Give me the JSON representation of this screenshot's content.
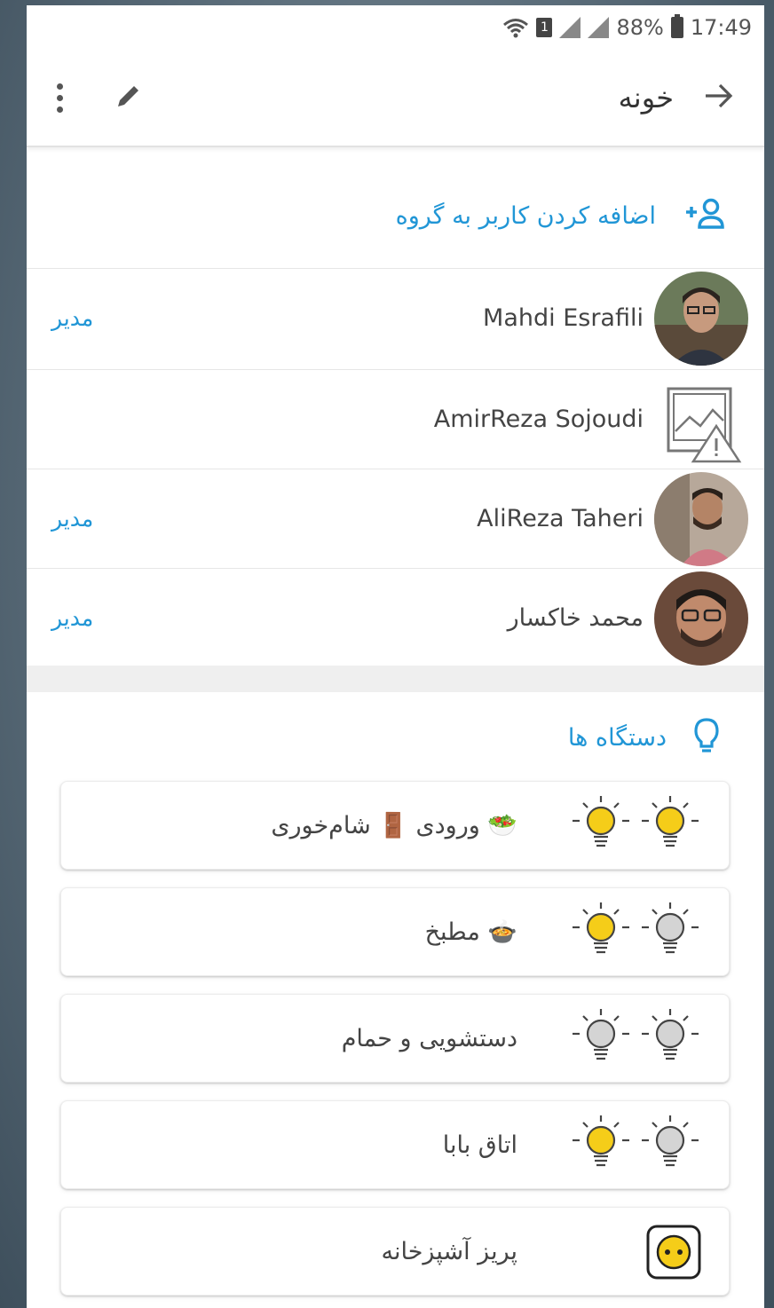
{
  "status_bar": {
    "battery": "88%",
    "time": "17:49",
    "sim": "1"
  },
  "app_bar": {
    "title": "خونه"
  },
  "add_user": {
    "label": "اضافه کردن کاربر به گروه"
  },
  "members": [
    {
      "name": "Mahdi Esrafili",
      "role": "مدیر",
      "avatar": "photo"
    },
    {
      "name": "AmirReza Sojoudi",
      "role": "",
      "avatar": "broken-image"
    },
    {
      "name": "AliReza Taheri",
      "role": "مدیر",
      "avatar": "photo"
    },
    {
      "name": "محمد خاکسار",
      "role": "مدیر",
      "avatar": "photo"
    }
  ],
  "devices_header": {
    "label": "دستگاه ها"
  },
  "devices": [
    {
      "label": "ورودی 🚪 شام‌خوری 🥗",
      "type": "lights",
      "lights": [
        true,
        true
      ]
    },
    {
      "label": "مطبخ 🍲",
      "type": "lights",
      "lights": [
        true,
        false
      ]
    },
    {
      "label": "دستشویی و حمام",
      "type": "lights",
      "lights": [
        false,
        false
      ]
    },
    {
      "label": "اتاق بابا",
      "type": "lights",
      "lights": [
        true,
        false
      ]
    },
    {
      "label": "پریز آشپزخانه",
      "type": "socket"
    }
  ],
  "colors": {
    "accent": "#2196d6",
    "bulb_on": "#f5cd19",
    "bulb_off": "#d4d4d4"
  }
}
